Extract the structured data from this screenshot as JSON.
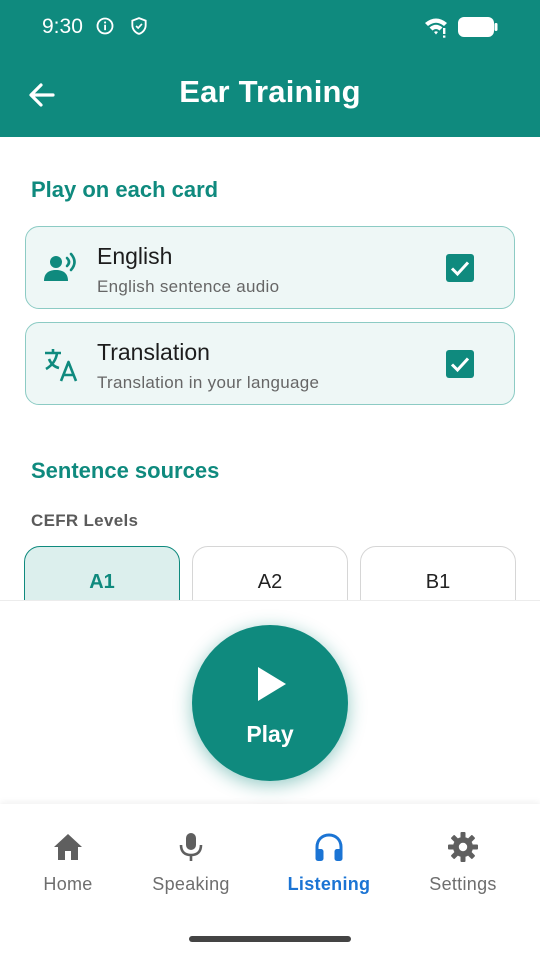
{
  "status_bar": {
    "time": "9:30",
    "icons": [
      "info-icon",
      "shield-icon",
      "wifi-icon",
      "battery-icon"
    ]
  },
  "app_bar": {
    "title": "Ear Training",
    "back_icon": "arrow-left-icon"
  },
  "colors": {
    "primary": "#0f8a7e",
    "nav_active": "#1b74d4",
    "card_bg": "#eef7f6",
    "card_border": "#8ccbc4"
  },
  "play_section": {
    "title": "Play on each card",
    "options": [
      {
        "title": "English",
        "subtitle": "English sentence audio",
        "icon": "record-voice-icon",
        "checked": true
      },
      {
        "title": "Translation",
        "subtitle": "Translation in your language",
        "icon": "translate-icon",
        "checked": true
      }
    ]
  },
  "sources_section": {
    "title": "Sentence sources",
    "cefr_label": "CEFR Levels",
    "levels": [
      {
        "label": "A1",
        "selected": true
      },
      {
        "label": "A2",
        "selected": false
      },
      {
        "label": "B1",
        "selected": false
      }
    ]
  },
  "play_button": {
    "label": "Play",
    "icon": "play-icon"
  },
  "bottom_nav": {
    "items": [
      {
        "label": "Home",
        "icon": "home-icon",
        "active": false
      },
      {
        "label": "Speaking",
        "icon": "microphone-icon",
        "active": false
      },
      {
        "label": "Listening",
        "icon": "headphones-icon",
        "active": true
      },
      {
        "label": "Settings",
        "icon": "gear-icon",
        "active": false
      }
    ]
  }
}
